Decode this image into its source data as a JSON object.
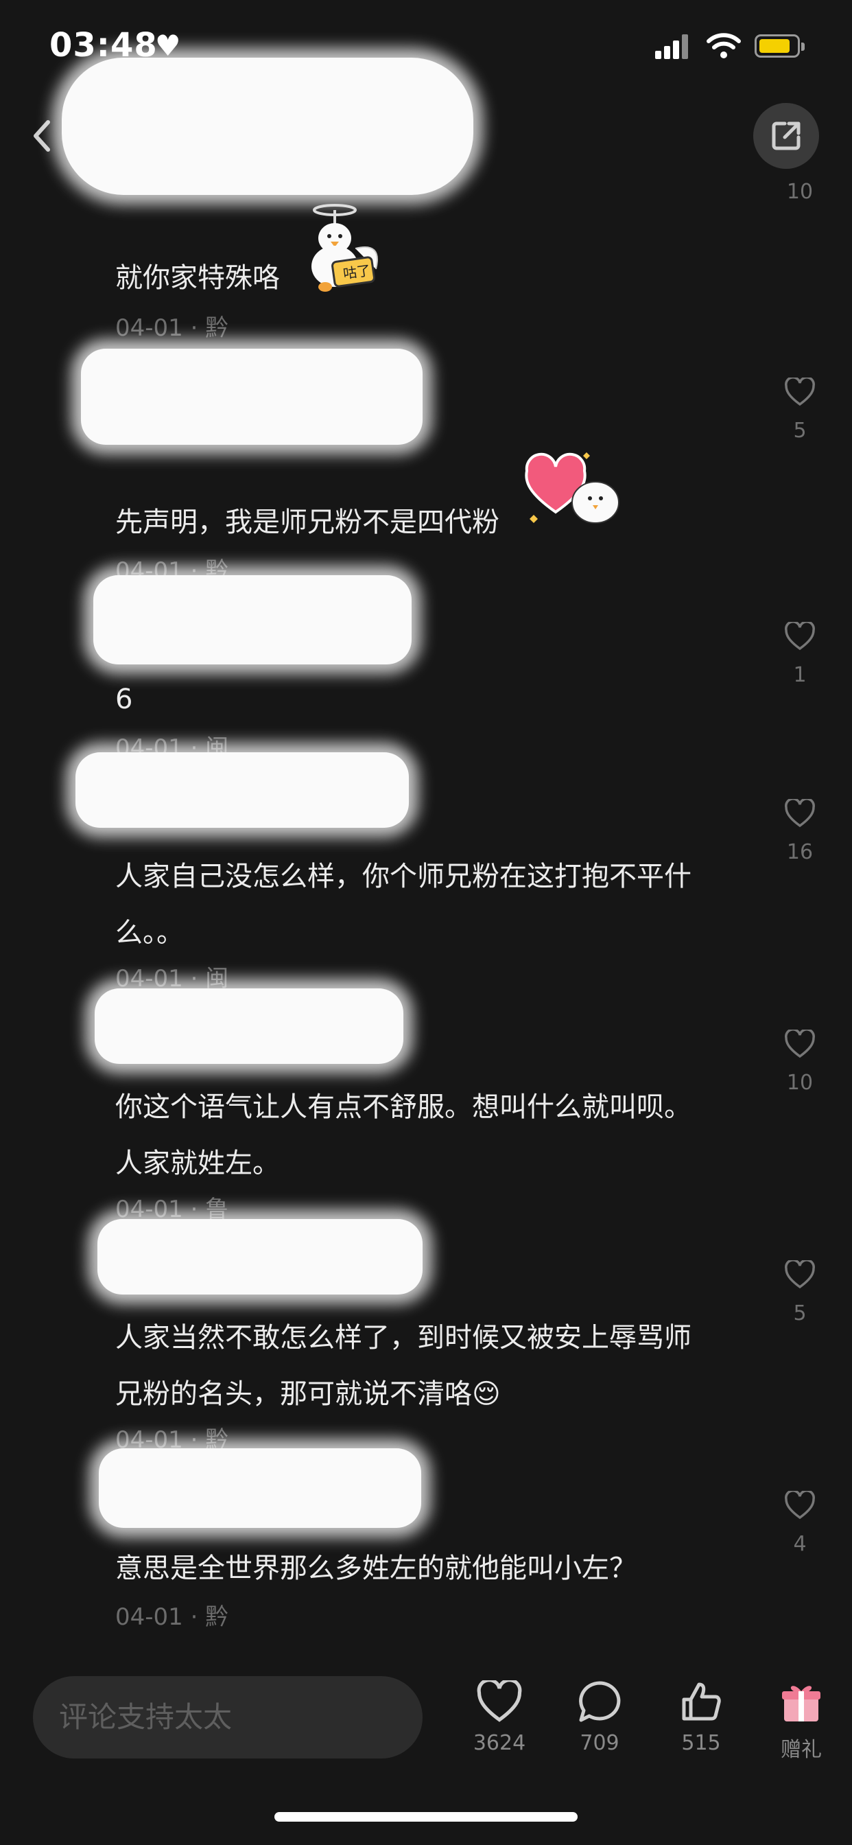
{
  "status_bar": {
    "time": "03:48"
  },
  "header": {
    "following_count": "10"
  },
  "comments": [
    {
      "text": "就你家特殊咯",
      "meta": "04-01 · 黔"
    },
    {
      "text": "先声明，我是师兄粉不是四代粉",
      "meta": "04-01 · 黔",
      "likes": "5"
    },
    {
      "text": "6",
      "meta": "04-01 · 闽",
      "likes": "1"
    },
    {
      "text": "人家自己没怎么样，你个师兄粉在这打抱不平什么。。",
      "meta": "04-01 · 闽",
      "likes": "16"
    },
    {
      "text": "你这个语气让人有点不舒服。想叫什么就叫呗。人家就姓左。",
      "meta": "04-01 · 鲁",
      "likes": "10"
    },
    {
      "text": "人家当然不敢怎么样了，到时候又被安上辱骂师兄粉的名头，那可就说不清咯😌",
      "meta": "04-01 · 黔",
      "likes": "5"
    },
    {
      "text": "意思是全世界那么多姓左的就他能叫小左？",
      "meta": "04-01 · 黔",
      "likes": "4"
    }
  ],
  "sticker_text": "咕了",
  "bottom_bar": {
    "input_placeholder": "评论支持太太",
    "like_count": "3624",
    "comment_count": "709",
    "thumb_count": "515",
    "gift_label": "赠礼"
  }
}
